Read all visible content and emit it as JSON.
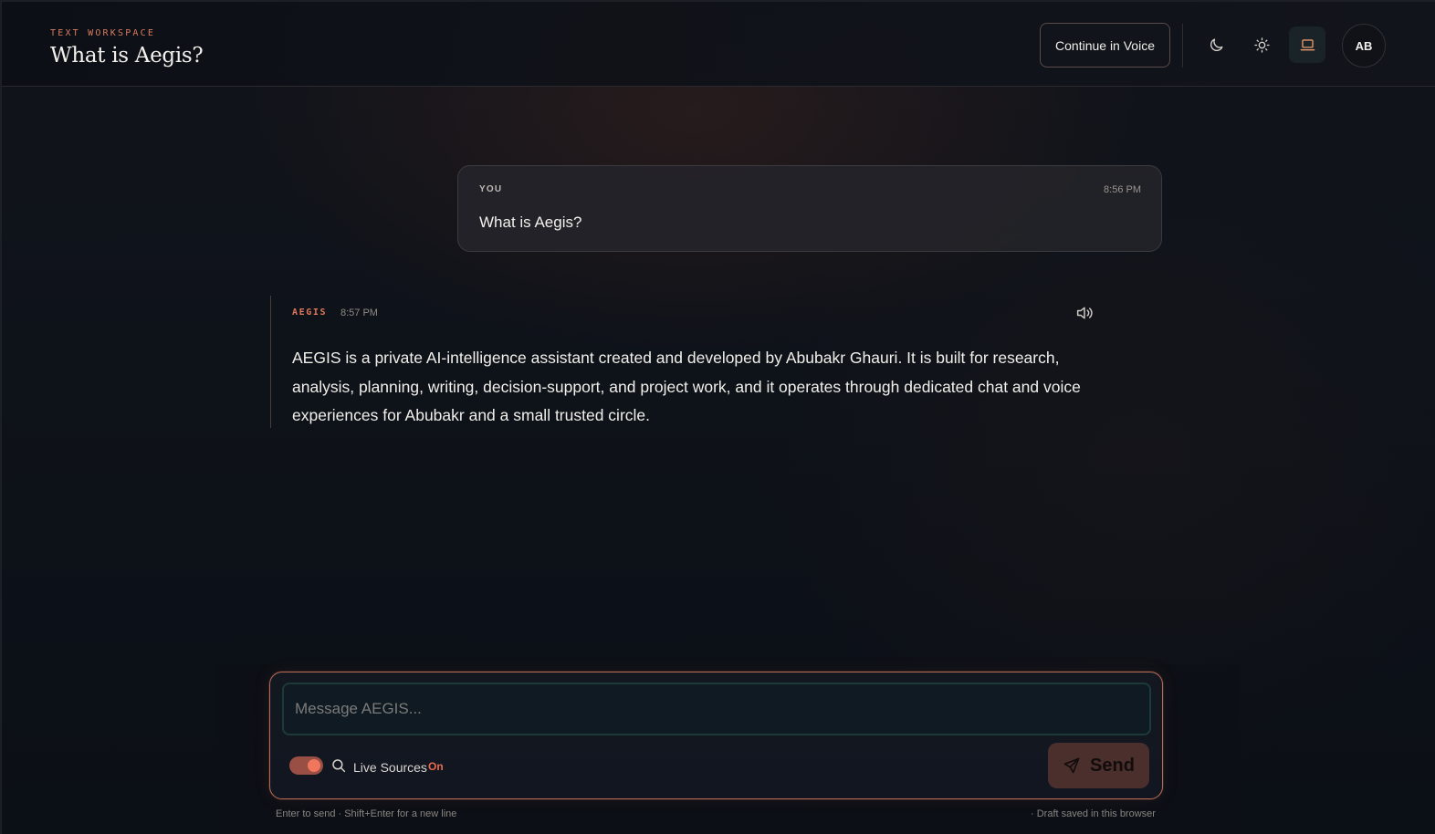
{
  "header": {
    "eyebrow": "TEXT WORKSPACE",
    "title": "What is Aegis?",
    "voice_button": "Continue in Voice",
    "avatar_initials": "AB"
  },
  "icons": {
    "dark_mode": "moon-icon",
    "light_mode": "sun-icon",
    "system_mode": "laptop-icon",
    "speaker": "speaker-icon",
    "search": "search-icon",
    "send": "send-icon"
  },
  "messages": {
    "user": {
      "label": "YOU",
      "time": "8:56 PM",
      "text": "What is Aegis?"
    },
    "assistant": {
      "label": "AEGIS",
      "time": "8:57 PM",
      "text": "AEGIS is a private AI-intelligence assistant created and developed by Abubakr Ghauri. It is built for research, analysis, planning, writing, decision-support, and project work, and it operates through dedicated chat and voice experiences for Abubakr and a small trusted circle."
    }
  },
  "composer": {
    "placeholder": "Message AEGIS...",
    "value": "",
    "live_sources_label": "Live Sources",
    "live_sources_state": "On",
    "send_label": "Send",
    "hint_left": "Enter to send · Shift+Enter for a new line",
    "hint_right": "· Draft saved in this browser"
  },
  "colors": {
    "accent": "#e0795b",
    "background": "#0d1118",
    "send_button": "#4a2f2c"
  }
}
